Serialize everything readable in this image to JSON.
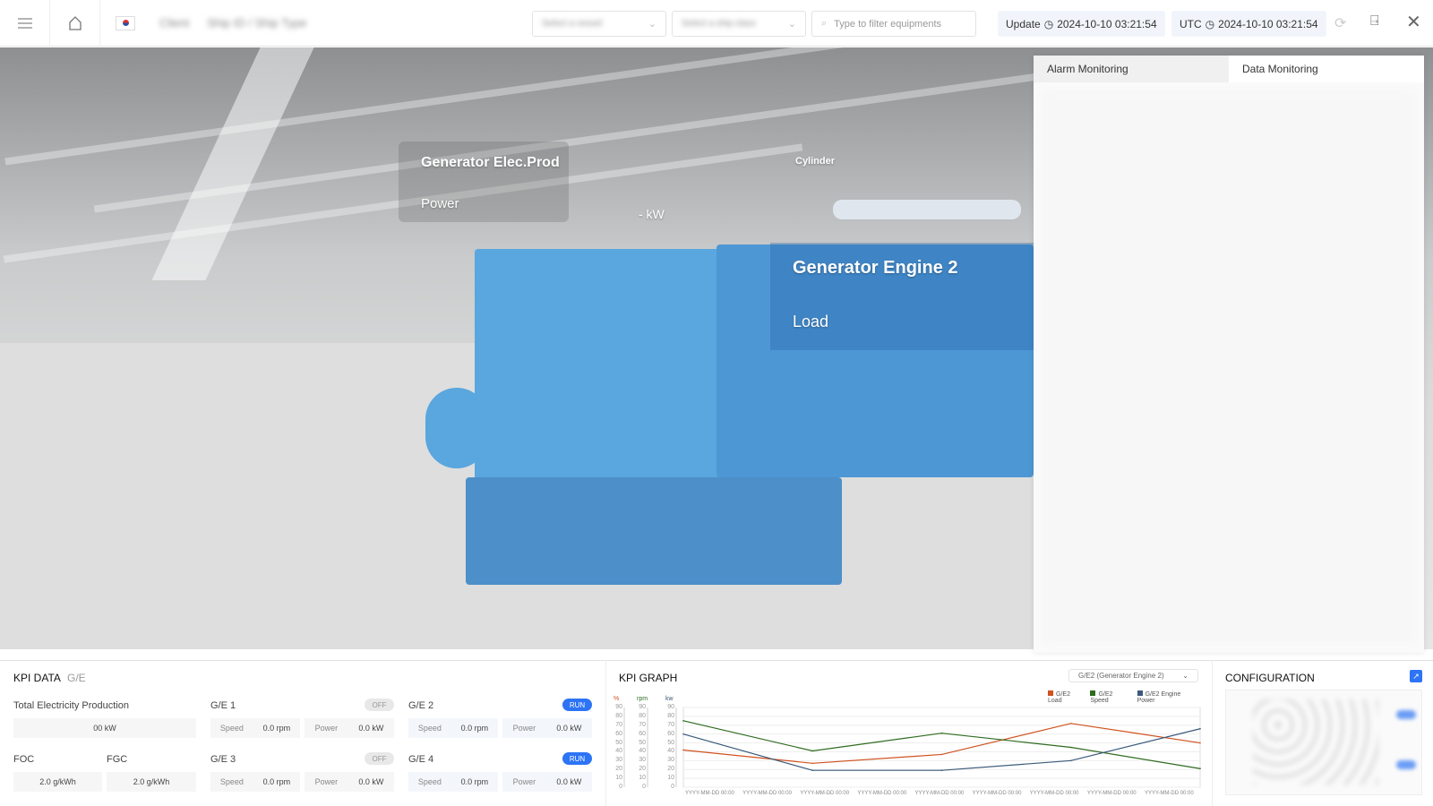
{
  "topbar": {
    "breadcrumb_1": "Client",
    "breadcrumb_2": "Ship ID / Ship Type",
    "select_vessel": "Select a vessel",
    "select_ship": "Select a ship class",
    "filter_placeholder": "Type to filter equipments",
    "update_label": "Update",
    "update_time": "2024-10-10 03:21:54",
    "utc_label": "UTC",
    "utc_time": "2024-10-10 03:21:54"
  },
  "scene": {
    "elec_title": "Generator Elec.Prod",
    "elec_power": "Power",
    "elec_value": "- kW",
    "cylinder": "Cylinder",
    "engine_title": "Generator Engine 2",
    "engine_load": "Load"
  },
  "panel": {
    "tabs": [
      "Alarm Monitoring",
      "Data Monitoring"
    ],
    "active_tab": 1
  },
  "kpi": {
    "title": "KPI DATA",
    "subtitle": "G/E",
    "total_label": "Total Electricity Production",
    "total_value": "00 kW",
    "foc_label": "FOC",
    "foc_value": "2.0 g/kWh",
    "fgc_label": "FGC",
    "fgc_value": "2.0 g/kWh",
    "engines": [
      {
        "name": "G/E 1",
        "status": "OFF",
        "speed_label": "Speed",
        "speed": "0.0 rpm",
        "power_label": "Power",
        "power": "0.0 kW"
      },
      {
        "name": "G/E 2",
        "status": "RUN",
        "speed_label": "Speed",
        "speed": "0.0 rpm",
        "power_label": "Power",
        "power": "0.0 kW"
      },
      {
        "name": "G/E 3",
        "status": "OFF",
        "speed_label": "Speed",
        "speed": "0.0 rpm",
        "power_label": "Power",
        "power": "0.0 kW"
      },
      {
        "name": "G/E 4",
        "status": "RUN",
        "speed_label": "Speed",
        "speed": "0.0 rpm",
        "power_label": "Power",
        "power": "0.0 kW"
      }
    ]
  },
  "graph": {
    "title": "KPI GRAPH",
    "select": "G/E2 (Generator Engine 2)"
  },
  "config": {
    "title": "CONFIGURATION"
  },
  "chart_data": {
    "type": "line",
    "axes": [
      "%",
      "rpm",
      "kw"
    ],
    "ylim": [
      0,
      90
    ],
    "yticks": [
      0,
      10,
      20,
      30,
      40,
      50,
      60,
      70,
      80,
      90
    ],
    "x_labels": [
      "YYYY-MM-DD 00:00",
      "YYYY-MM-DD 00:00",
      "YYYY-MM-DD 00:00",
      "YYYY-MM-DD 00:00",
      "YYYY-MM-DD 00:00",
      "YYYY-MM-DD 00:00",
      "YYYY-MM-DD 00:00",
      "YYYY-MM-DD 00:00",
      "YYYY-MM-DD 00:00"
    ],
    "series": [
      {
        "name": "G/E2 Load",
        "color": "#d0521f",
        "values": [
          42,
          27,
          37,
          72,
          50
        ]
      },
      {
        "name": "G/E2 Speed",
        "color": "#2e6b1f",
        "values": [
          75,
          41,
          61,
          45,
          21
        ]
      },
      {
        "name": "G/E2 Engine Power",
        "color": "#3a5a7a",
        "values": [
          60,
          19,
          19,
          30,
          66
        ]
      }
    ]
  }
}
